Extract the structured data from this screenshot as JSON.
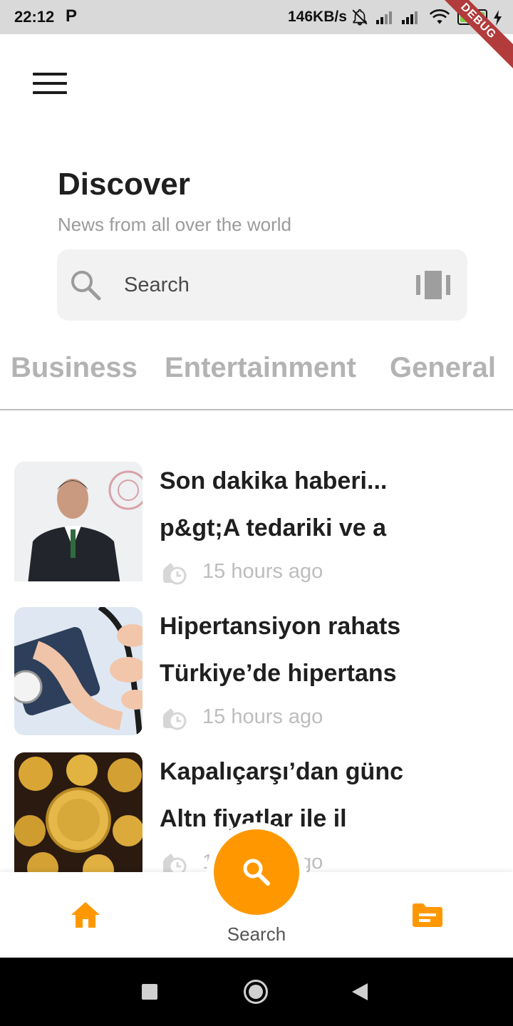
{
  "status_bar": {
    "time": "22:12",
    "app_indicator": "P",
    "network_speed": "146KB/s",
    "battery_level": "92",
    "debug_banner": "DEBUG",
    "icons": [
      "notifications-off-icon",
      "signal-icon",
      "signal-icon",
      "wifi-icon",
      "battery-icon",
      "charging-icon"
    ]
  },
  "header": {
    "menu_icon": "hamburger-menu-icon",
    "title": "Discover",
    "subtitle": "News from all over the world"
  },
  "search": {
    "placeholder": "Search",
    "left_icon": "search-icon",
    "right_icon": "view-carousel-icon"
  },
  "categories": [
    {
      "label": "Business"
    },
    {
      "label": "Entertainment"
    },
    {
      "label": "General"
    }
  ],
  "articles": [
    {
      "title_line1": "Son dakika haberi...",
      "title_line2": "p&gt;A tedariki ve a",
      "time": "15 hours ago",
      "image": "man in suit at podium"
    },
    {
      "title_line1": "Hipertansiyon rahats",
      "title_line2": "Türkiye’de hipertans",
      "time": "15 hours ago",
      "image": "blood pressure measurement"
    },
    {
      "title_line1": "Kapalıçarşı’dan günc",
      "title_line2": "Altn fiyatlar ile il",
      "time": "15 hours ago",
      "image": "gold coins"
    }
  ],
  "bottom_nav": {
    "home_icon": "home-icon",
    "search_label": "Search",
    "search_icon": "search-icon",
    "saved_icon": "article-icon",
    "accent_color": "#FF9800"
  },
  "system_nav": {
    "buttons": [
      "recents-button",
      "home-button",
      "back-button"
    ]
  }
}
